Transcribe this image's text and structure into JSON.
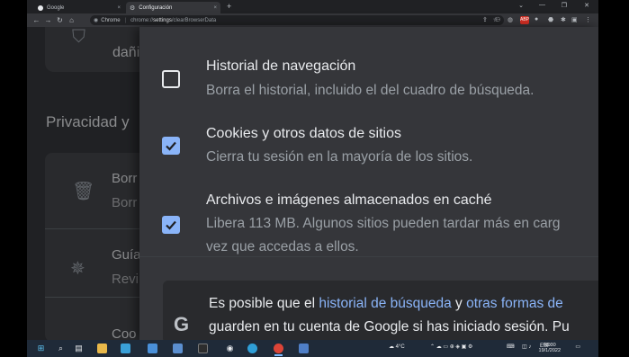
{
  "browser": {
    "tabs": [
      {
        "label": "Google",
        "close": "×"
      },
      {
        "label": "Configuración",
        "close": "×"
      }
    ],
    "new_tab": "+",
    "window_controls": {
      "dropdown": "⌄",
      "minimize": "—",
      "maximize": "❐",
      "close": "✕"
    },
    "toolbar": {
      "back": "←",
      "forward": "→",
      "reload": "↻",
      "home": "⌂",
      "address_prefix": "Chrome",
      "address_separator": "|",
      "address_scheme": "chrome://",
      "address_host": "settings",
      "address_path": "/clearBrowserData",
      "share": "⇪",
      "star": "☆"
    },
    "extensions": [
      "⚇",
      "◍",
      "ABP",
      "●",
      "⬣",
      "✱",
      "▣",
      "⋮"
    ]
  },
  "settings_page": {
    "top_card_text": "dañi",
    "privacy_heading": "Privacidad y",
    "rows": [
      {
        "title": "Borr",
        "subtitle": "Borr",
        "icon": "trash-icon"
      },
      {
        "title": "Guía",
        "subtitle": "Revi",
        "icon": "compass-icon"
      },
      {
        "title": "Coo",
        "subtitle": "",
        "icon": "cookie-icon"
      }
    ]
  },
  "dialog": {
    "items": [
      {
        "title": "Historial de navegación",
        "description": "Borra el historial, incluido el del cuadro de búsqueda.",
        "checked": false
      },
      {
        "title": "Cookies y otros datos de sitios",
        "description": "Cierra tu sesión en la mayoría de los sitios.",
        "checked": true
      },
      {
        "title": "Archivos e imágenes almacenados en caché",
        "description_line1": "Libera 113 MB. Algunos sitios pueden tardar más en carg",
        "description_line2": "vez que accedas a ellos.",
        "checked": true
      }
    ],
    "google_notice": {
      "g_letter": "G",
      "line1_prefix": "Es posible que el ",
      "link1": "historial de búsqueda",
      "line1_mid": " y ",
      "link2": "otras formas de",
      "line2": "guarden en tu cuenta de Google si has iniciado sesión. Pu"
    }
  },
  "taskbar": {
    "weather": "4°C",
    "language": "ESP",
    "time": "08:30",
    "date": "19/1/2022"
  },
  "colors": {
    "accent": "#8ab4f8",
    "dialog_bg": "#35363a",
    "page_bg": "#202124",
    "taskbar_bg": "#1f2a38"
  }
}
